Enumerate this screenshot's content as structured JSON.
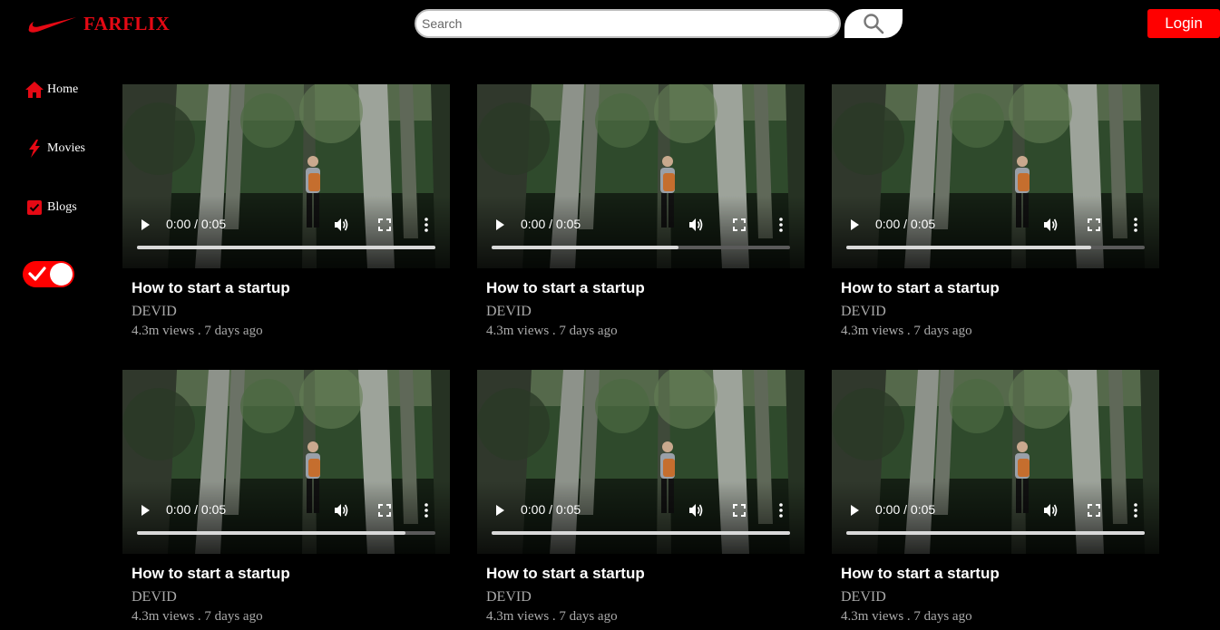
{
  "app": {
    "name": "FARFLIX",
    "brand_color": "#e50914",
    "logo_icon": "swoosh-icon"
  },
  "search": {
    "placeholder": "Search",
    "value": "",
    "button_icon": "magnifier-icon"
  },
  "header": {
    "login_label": "Login",
    "login_color": "#ff0000"
  },
  "sidebar": {
    "items": [
      {
        "label": "Home",
        "icon": "home-icon"
      },
      {
        "label": "Movies",
        "icon": "lightning-icon"
      },
      {
        "label": "Blogs",
        "icon": "checkbox-icon"
      }
    ],
    "theme_toggle": {
      "state": "on",
      "icon": "check-icon"
    }
  },
  "videos": [
    {
      "title": "How to start a startup",
      "channel": "DEVID",
      "meta": "4.3m views . 7 days ago",
      "time": "0:00 / 0:05",
      "progress": 1.0
    },
    {
      "title": "How to start a startup",
      "channel": "DEVID",
      "meta": "4.3m views . 7 days ago",
      "time": "0:00 / 0:05",
      "progress": 0.625
    },
    {
      "title": "How to start a startup",
      "channel": "DEVID",
      "meta": "4.3m views . 7 days ago",
      "time": "0:00 / 0:05",
      "progress": 0.82
    },
    {
      "title": "How to start a startup",
      "channel": "DEVID",
      "meta": "4.3m views . 7 days ago",
      "time": "0:00 / 0:05",
      "progress": 0.9
    },
    {
      "title": "How to start a startup",
      "channel": "DEVID",
      "meta": "4.3m views . 7 days ago",
      "time": "0:00 / 0:05",
      "progress": 1.0
    },
    {
      "title": "How to start a startup",
      "channel": "DEVID",
      "meta": "4.3m views . 7 days ago",
      "time": "0:00 / 0:05",
      "progress": 1.0
    }
  ]
}
